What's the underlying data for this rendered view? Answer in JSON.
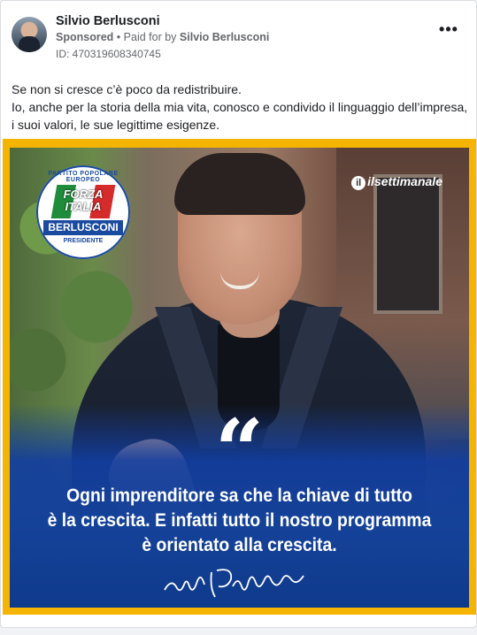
{
  "post": {
    "page_name": "Silvio Berlusconi",
    "sponsored_label": "Sponsored",
    "separator": "•",
    "paid_for_label": "Paid for by",
    "payer": "Silvio Berlusconi",
    "ad_id": "ID: 470319608340745",
    "more_icon": "more-options-icon",
    "more_glyph": "•••",
    "text_lines": [
      "Se non si cresce c’è poco da redistribuire.",
      "Io, anche per la storia della mia vita, conosco e condivido il linguaggio dell’impresa,",
      "i suoi valori, le sue legittime esigenze."
    ]
  },
  "image": {
    "quote_mark": "“",
    "quote_lines": [
      "Ogni imprenditore sa che la chiave di tutto",
      "è la crescita. E infatti tutto il nostro programma",
      "è orientato alla crescita."
    ],
    "logo": {
      "ring_text": "PARTITO POPOLARE EUROPEO",
      "party": "FORZA ITALIA",
      "name": "BERLUSCONI",
      "role": "PRESIDENTE"
    },
    "brand": "ilsettimanale",
    "colors": {
      "frame": "#f4b400",
      "band": "#154299",
      "logo_blue": "#1a4aa0"
    }
  }
}
